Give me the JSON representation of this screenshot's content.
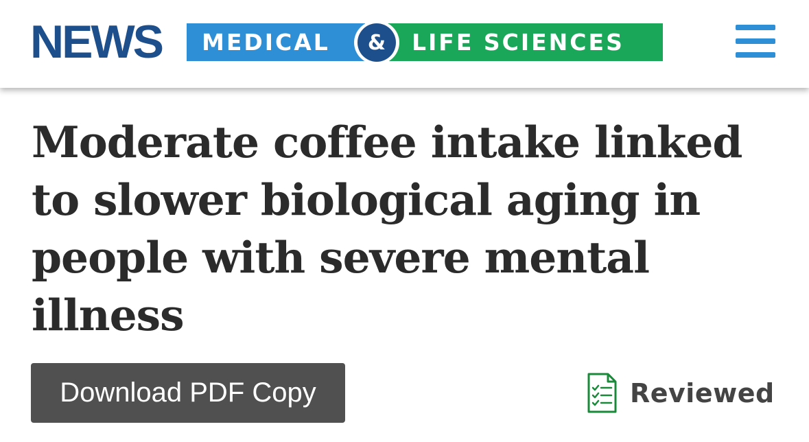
{
  "header": {
    "logo": {
      "news": "NEWS",
      "medical": "MEDICAL",
      "ampersand": "&",
      "life_sciences": "LIFE SCIENCES"
    },
    "menu_icon": "hamburger-menu-icon"
  },
  "article": {
    "title": "Moderate coffee intake linked to slower biological aging in people with severe mental illness"
  },
  "actions": {
    "download_label": "Download PDF Copy",
    "reviewed_label": "Reviewed",
    "reviewed_icon": "checklist-document-icon"
  },
  "colors": {
    "brand_navy": "#1d4f8c",
    "brand_blue": "#2f8fd6",
    "brand_green": "#1aa759",
    "button_gray": "#505050",
    "reviewed_green": "#1a8a3a"
  }
}
